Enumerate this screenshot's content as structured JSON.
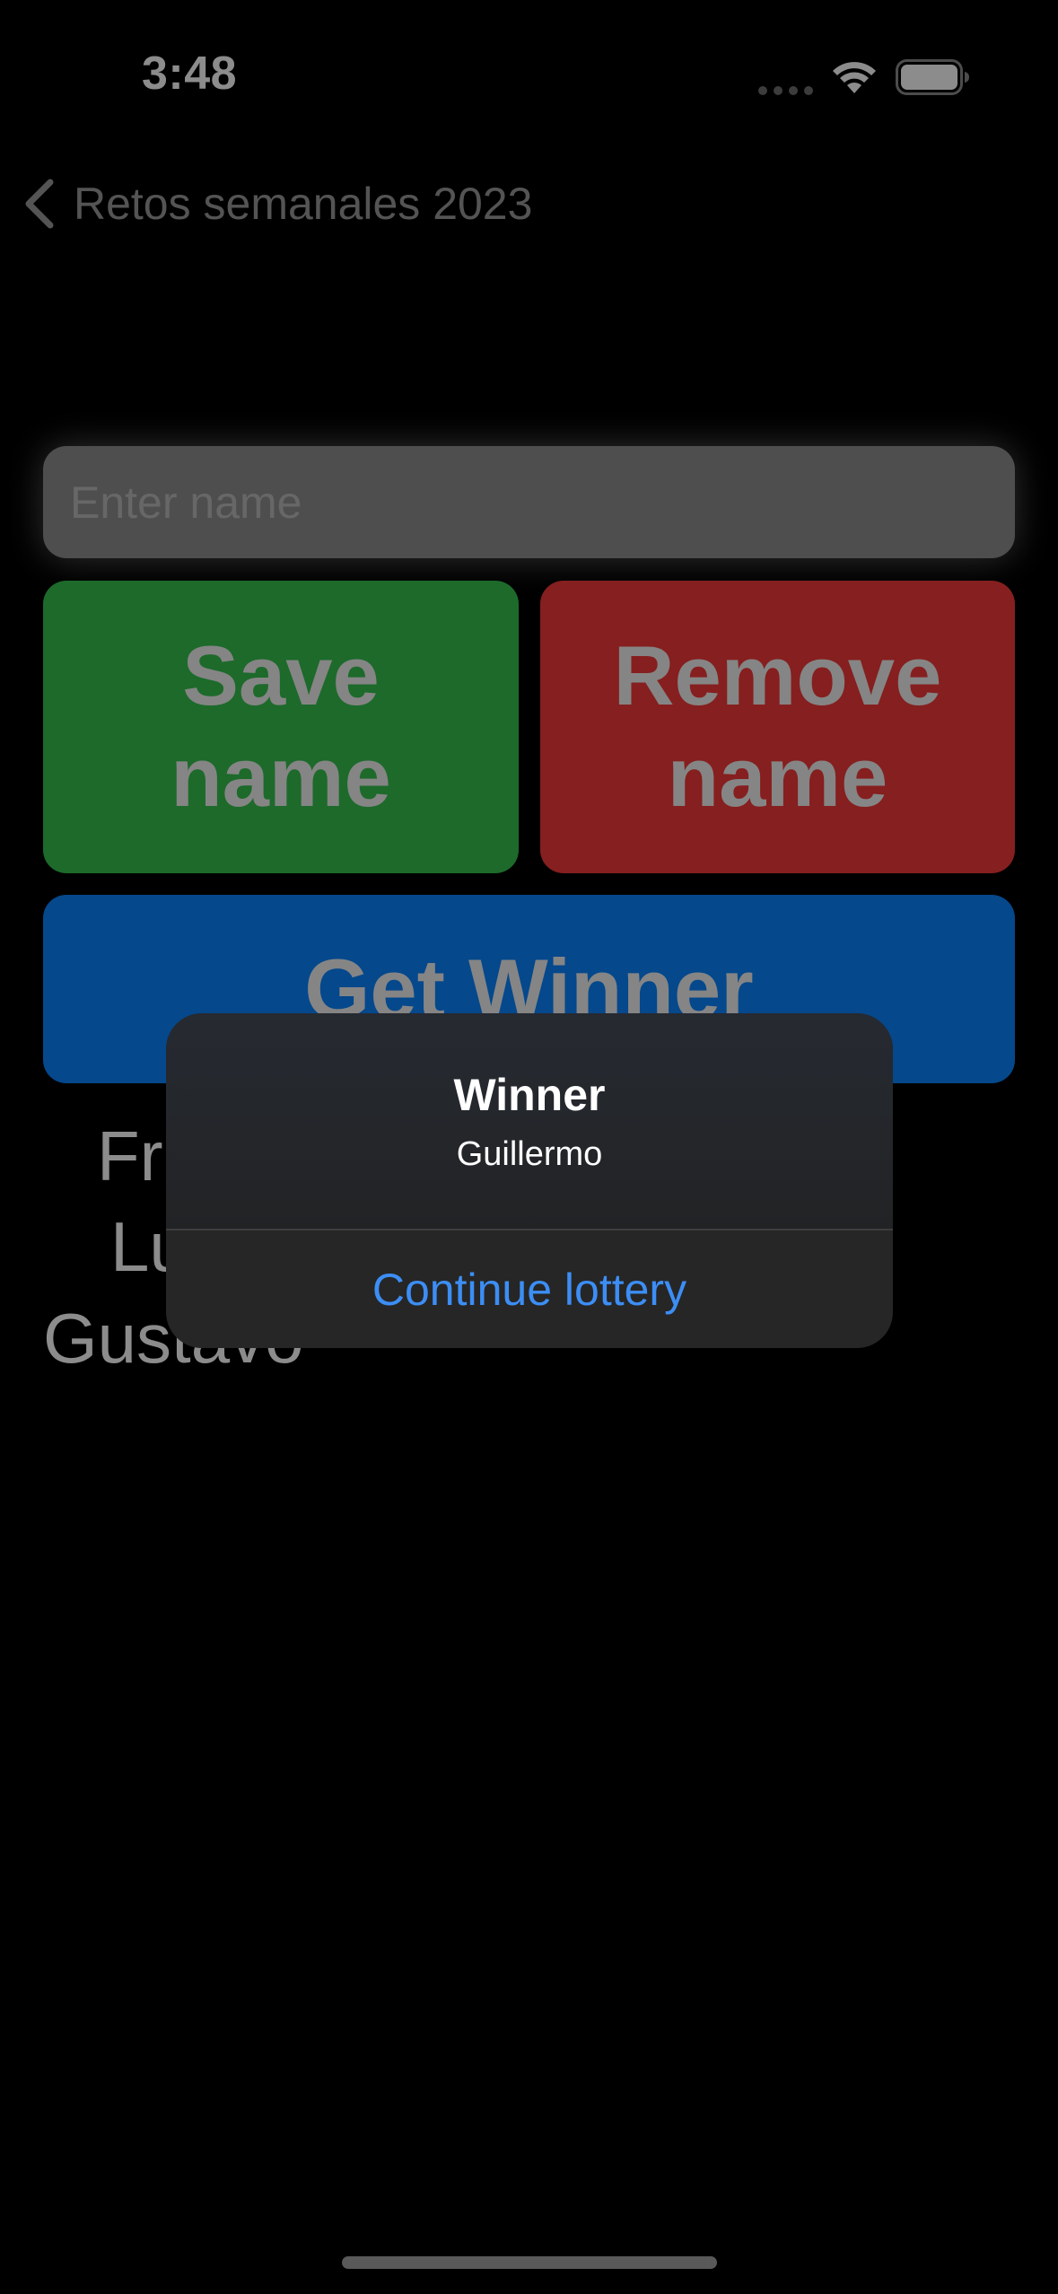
{
  "status_bar": {
    "time": "3:48"
  },
  "nav": {
    "back_label": "Retos semanales 2023"
  },
  "form": {
    "name_placeholder": "Enter name",
    "save_label": "Save name",
    "remove_label": "Remove name",
    "get_winner_label": "Get Winner"
  },
  "names": [
    "Fri",
    "Lu",
    "Gustavo"
  ],
  "alert": {
    "title": "Winner",
    "message": "Guillermo",
    "action_label": "Continue lottery"
  },
  "colors": {
    "save": "#36c24f",
    "remove": "#f43a3a",
    "get_winner": "#0a84ff",
    "alert_action": "#3c8ef5"
  }
}
